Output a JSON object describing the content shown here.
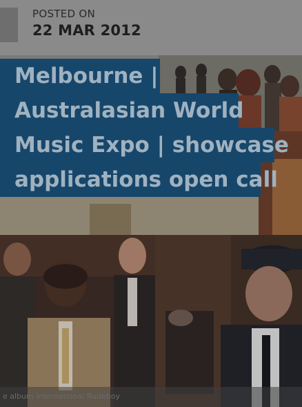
{
  "post": {
    "posted_label": "POSTED ON",
    "posted_date": "22 MAR 2012"
  },
  "hero": {
    "title_lines": [
      "Melbourne |",
      "Australasian World",
      "Music Expo | showcase",
      "applications open call"
    ],
    "caption": "e album International Rudeboy"
  },
  "colors": {
    "title_background": "#17466b",
    "title_text": "#9fb2c0",
    "header_background": "#8a8a8a"
  }
}
